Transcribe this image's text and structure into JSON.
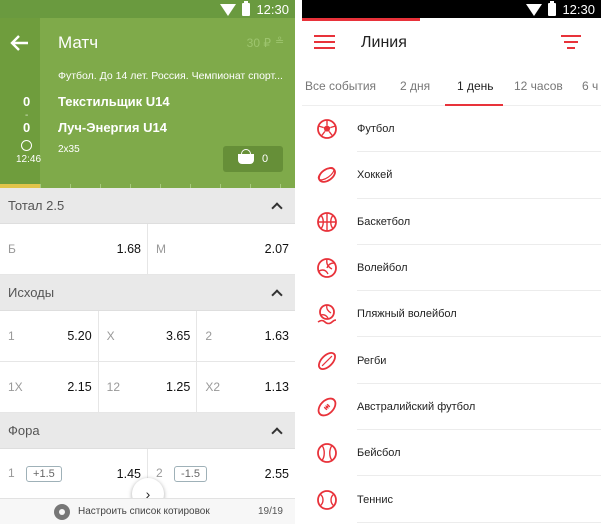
{
  "colors": {
    "accent_red": "#e8323a",
    "header_green": "#7faa4a",
    "status_green": "#6a9a3f"
  },
  "left": {
    "status_time": "12:30",
    "header": {
      "title": "Матч",
      "balance": "30 ₽",
      "league": "Футбол. До 14 лет. Россия. Чемпионат спорт...",
      "team1": "Текстильщик U14",
      "team2": "Луч-Энергия U14",
      "score1": "0",
      "score2": "0",
      "score_sep": "-",
      "time": "12:46",
      "format": "2x35",
      "basket_count": "0"
    },
    "markets": [
      {
        "title": "Тотал 2.5",
        "rows": [
          [
            {
              "name": "Б",
              "value": "1.68"
            },
            {
              "name": "М",
              "value": "2.07"
            }
          ]
        ]
      },
      {
        "title": "Исходы",
        "rows": [
          [
            {
              "name": "1",
              "value": "5.20"
            },
            {
              "name": "Х",
              "value": "3.65"
            },
            {
              "name": "2",
              "value": "1.63"
            }
          ],
          [
            {
              "name": "1Х",
              "value": "2.15"
            },
            {
              "name": "12",
              "value": "1.25"
            },
            {
              "name": "Х2",
              "value": "1.13"
            }
          ]
        ]
      },
      {
        "title": "Фора",
        "rows": [
          [
            {
              "name": "1",
              "handicap": "+1.5",
              "value": "1.45"
            },
            {
              "name": "2",
              "handicap": "-1.5",
              "value": "2.55"
            }
          ]
        ]
      }
    ],
    "bottom_bar": {
      "label": "Настроить список котировок",
      "pager": "19/19"
    }
  },
  "right": {
    "status_time": "12:30",
    "title": "Линия",
    "tabs": [
      "Все события",
      "2 дня",
      "1 день",
      "12 часов",
      "6 ч"
    ],
    "active_tab_index": 2,
    "sports": [
      {
        "name": "Футбол",
        "icon": "football-icon"
      },
      {
        "name": "Хоккей",
        "icon": "hockey-icon"
      },
      {
        "name": "Баскетбол",
        "icon": "basketball-icon"
      },
      {
        "name": "Волейбол",
        "icon": "volleyball-icon"
      },
      {
        "name": "Пляжный волейбол",
        "icon": "beach-volleyball-icon"
      },
      {
        "name": "Регби",
        "icon": "rugby-icon"
      },
      {
        "name": "Австралийский футбол",
        "icon": "australian-football-icon"
      },
      {
        "name": "Бейсбол",
        "icon": "baseball-icon"
      },
      {
        "name": "Теннис",
        "icon": "tennis-icon"
      }
    ]
  }
}
